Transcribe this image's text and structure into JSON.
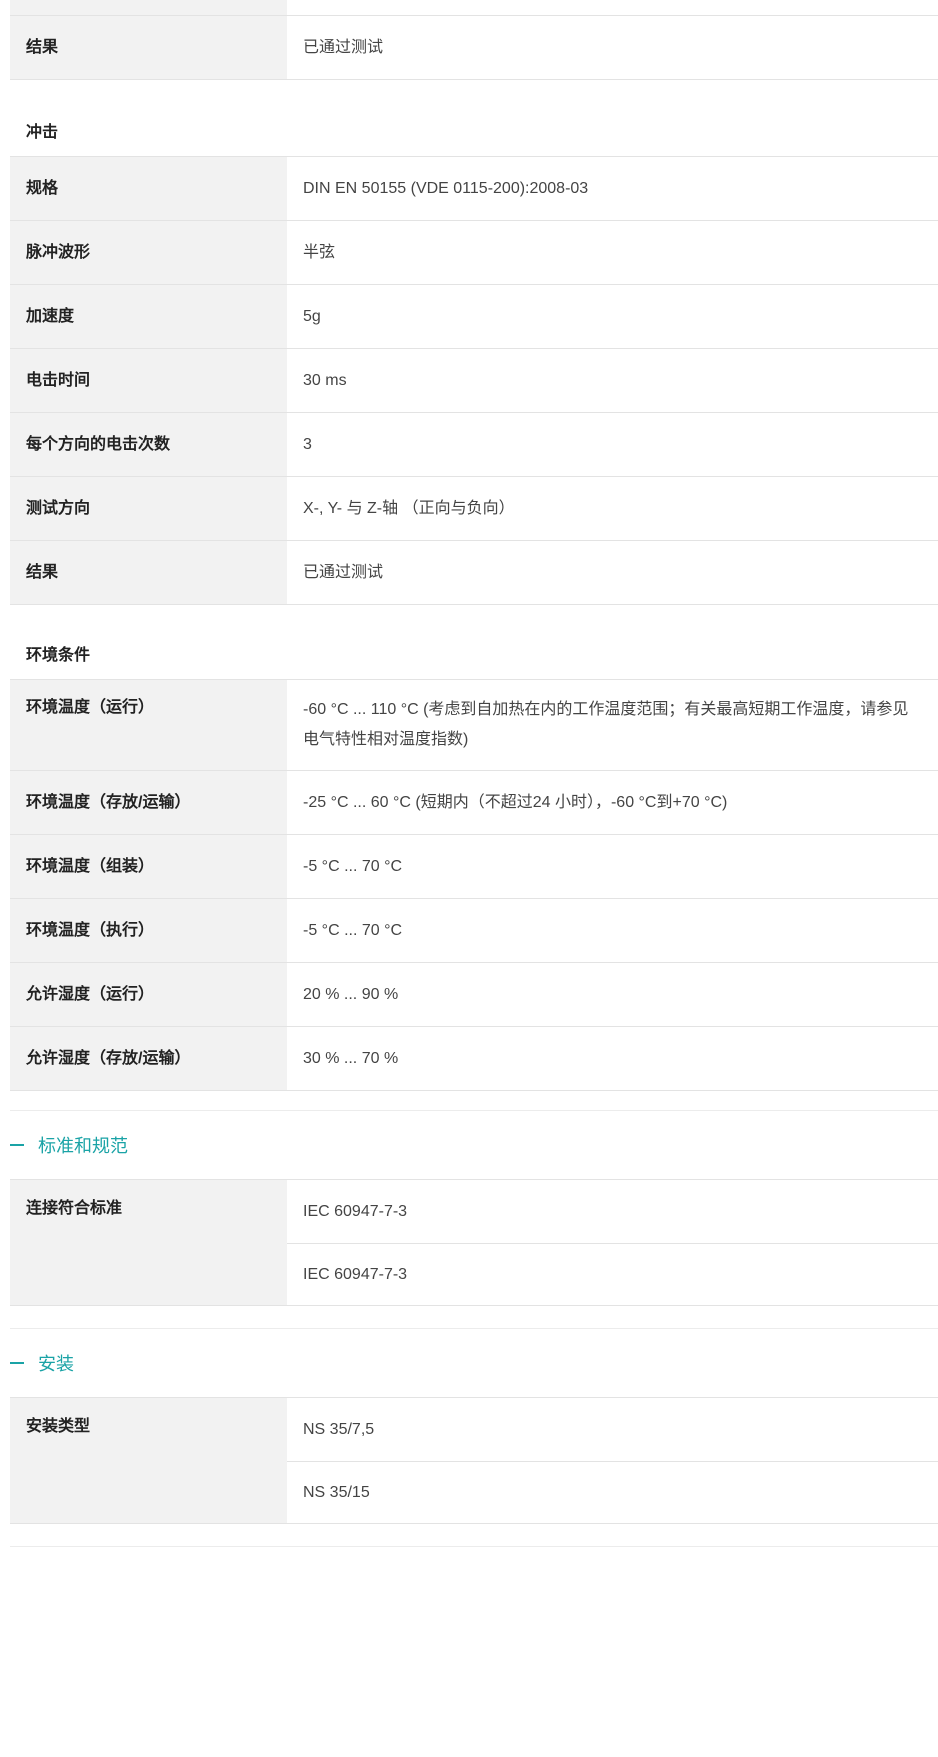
{
  "top_table": {
    "rows": [
      {
        "label": "结果",
        "value": "已通过测试"
      }
    ]
  },
  "shock": {
    "title": "冲击",
    "rows": [
      {
        "label": "规格",
        "value": "DIN EN 50155 (VDE 0115-200):2008-03"
      },
      {
        "label": "脉冲波形",
        "value": "半弦"
      },
      {
        "label": "加速度",
        "value": "5g"
      },
      {
        "label": "电击时间",
        "value": "30 ms"
      },
      {
        "label": "每个方向的电击次数",
        "value": "3"
      },
      {
        "label": "测试方向",
        "value": "X-, Y- 与 Z-轴 （正向与负向）"
      },
      {
        "label": "结果",
        "value": "已通过测试"
      }
    ]
  },
  "environment": {
    "title": "环境条件",
    "rows": [
      {
        "label": "环境温度（运行）",
        "value": "-60 °C ... 110 °C (考虑到自加热在内的工作温度范围；有关最高短期工作温度，请参见电气特性相对温度指数)"
      },
      {
        "label": "环境温度（存放/运输）",
        "value": "-25 °C ... 60 °C (短期内（不超过24  小时），-60 °C到+70 °C)"
      },
      {
        "label": "环境温度（组装）",
        "value": "-5 °C ... 70 °C"
      },
      {
        "label": "环境温度（执行）",
        "value": "-5 °C ... 70 °C"
      },
      {
        "label": "允许湿度（运行）",
        "value": "20 % ... 90 %"
      },
      {
        "label": "允许湿度（存放/运输）",
        "value": "30 % ... 70 %"
      }
    ]
  },
  "standards": {
    "title": "标准和规范",
    "label": "连接符合标准",
    "values": [
      "IEC 60947-7-3",
      "IEC 60947-7-3"
    ]
  },
  "mounting": {
    "title": "安装",
    "label": "安装类型",
    "values": [
      "NS 35/7,5",
      "NS 35/15"
    ]
  },
  "colors": {
    "accent": "#1aa3a6",
    "label_bg": "#f2f2f2",
    "border": "#e3e3e3"
  }
}
